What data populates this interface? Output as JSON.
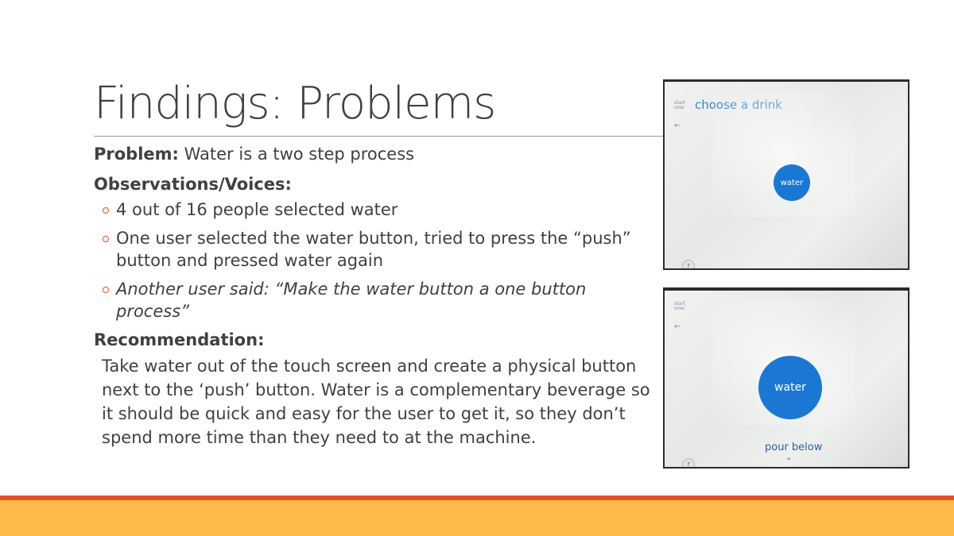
{
  "slide": {
    "title": "Findings: Problems",
    "problem_label": "Problem:",
    "problem_text": " Water is a two step process",
    "observations_heading": "Observations/Voices:",
    "observations": [
      "4 out of 16 people selected water",
      "One user selected the water button, tried to press the “push” button and pressed water again",
      "Another user said: “Make the water button a one button process”"
    ],
    "recommendation_heading": "Recommendation:",
    "recommendation_text": "Take water out of the touch screen and create a physical button next to the ‘push’ button. Water is a complementary beverage so it should be quick and easy for the user to get it, so they don’t spend more time than they need to at the machine."
  },
  "photo1": {
    "start_over": "start over",
    "heading": "choose a drink",
    "water_button": "water",
    "help": "?"
  },
  "photo2": {
    "start_over": "start over",
    "water_button": "water",
    "pour_below": "pour below",
    "help": "?"
  },
  "colors": {
    "accent_red": "#e0542a",
    "accent_orange": "#fdb94a",
    "water_blue": "#1a78d4",
    "text": "#404040"
  }
}
